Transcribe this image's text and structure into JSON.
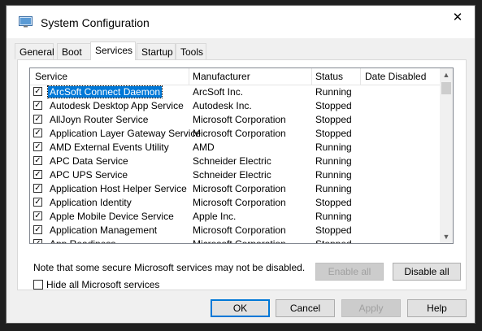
{
  "window": {
    "title": "System Configuration",
    "close_glyph": "✕",
    "app_icon": "system-configuration-icon"
  },
  "tabs": [
    {
      "label": "General"
    },
    {
      "label": "Boot"
    },
    {
      "label": "Services",
      "active": true
    },
    {
      "label": "Startup"
    },
    {
      "label": "Tools"
    }
  ],
  "list": {
    "columns": [
      "Service",
      "Manufacturer",
      "Status",
      "Date Disabled"
    ],
    "rows": [
      {
        "service": "ArcSoft Connect Daemon",
        "manufacturer": "ArcSoft Inc.",
        "status": "Running",
        "checked": true,
        "selected": true
      },
      {
        "service": "Autodesk Desktop App Service",
        "manufacturer": "Autodesk Inc.",
        "status": "Stopped",
        "checked": true
      },
      {
        "service": "AllJoyn Router Service",
        "manufacturer": "Microsoft Corporation",
        "status": "Stopped",
        "checked": true
      },
      {
        "service": "Application Layer Gateway Service",
        "manufacturer": "Microsoft Corporation",
        "status": "Stopped",
        "checked": true
      },
      {
        "service": "AMD External Events Utility",
        "manufacturer": "AMD",
        "status": "Running",
        "checked": true
      },
      {
        "service": "APC Data Service",
        "manufacturer": "Schneider Electric",
        "status": "Running",
        "checked": true
      },
      {
        "service": "APC UPS Service",
        "manufacturer": "Schneider Electric",
        "status": "Running",
        "checked": true
      },
      {
        "service": "Application Host Helper Service",
        "manufacturer": "Microsoft Corporation",
        "status": "Running",
        "checked": true
      },
      {
        "service": "Application Identity",
        "manufacturer": "Microsoft Corporation",
        "status": "Stopped",
        "checked": true
      },
      {
        "service": "Apple Mobile Device Service",
        "manufacturer": "Apple Inc.",
        "status": "Running",
        "checked": true
      },
      {
        "service": "Application Management",
        "manufacturer": "Microsoft Corporation",
        "status": "Stopped",
        "checked": true
      },
      {
        "service": "App Readiness",
        "manufacturer": "Microsoft Corporation",
        "status": "Stopped",
        "checked": true
      }
    ]
  },
  "note": "Note that some secure Microsoft services may not be disabled.",
  "buttons": {
    "enable_all": "Enable all",
    "disable_all": "Disable all",
    "ok": "OK",
    "cancel": "Cancel",
    "apply": "Apply",
    "help": "Help"
  },
  "hide_ms": {
    "label": "Hide all Microsoft services",
    "checked": false
  },
  "colors": {
    "selection": "#0078d7",
    "accent": "#0078d7"
  }
}
